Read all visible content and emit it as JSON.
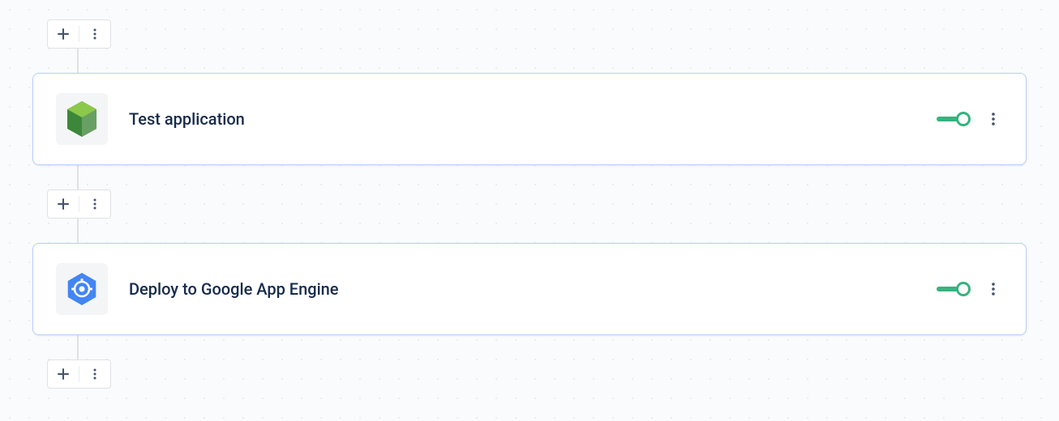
{
  "pipeline": {
    "steps": [
      {
        "title": "Test application",
        "icon": "nodejs",
        "enabled": true
      },
      {
        "title": "Deploy to Google App Engine",
        "icon": "gae",
        "enabled": true
      }
    ]
  }
}
